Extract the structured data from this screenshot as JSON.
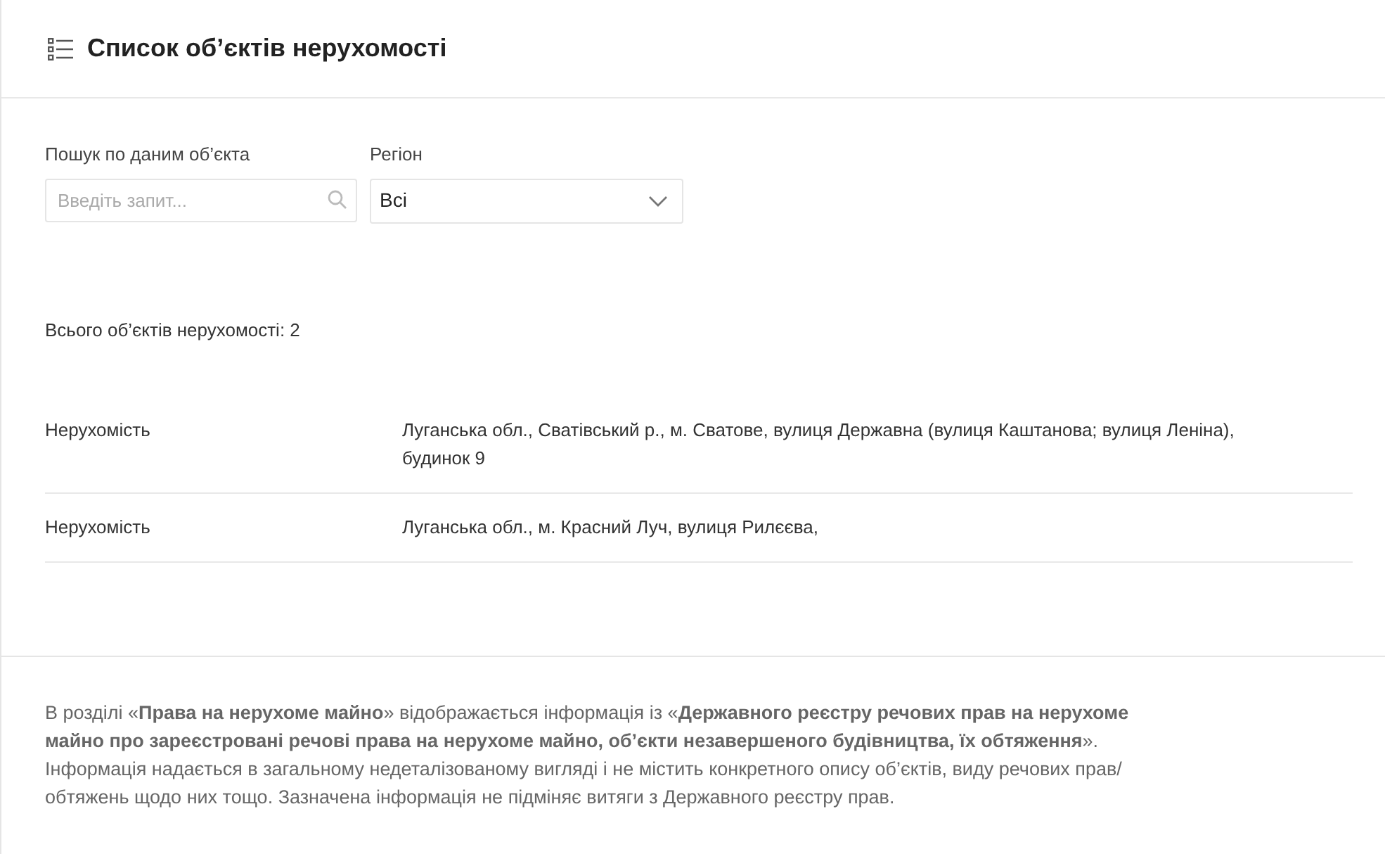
{
  "header": {
    "title": "Список об’єктів нерухомості"
  },
  "filters": {
    "search": {
      "label": "Пошук по даним об’єкта",
      "placeholder": "Введіть запит..."
    },
    "region": {
      "label": "Регіон",
      "value": "Всі"
    }
  },
  "total": "Всього об’єктів нерухомості: 2",
  "rows": [
    {
      "type": "Нерухомість",
      "address": "Луганська обл., Сватівський р., м. Сватове, вулиця Державна (вулиця Каштанова; вулиця Леніна), будинок 9"
    },
    {
      "type": "Нерухомість",
      "address": "Луганська обл., м. Красний Луч, вулиця Рилєєва,"
    }
  ],
  "note": "В розділі «**Права на нерухоме майно**» відображається інформація із «**Державного реєстру речових прав на нерухоме майно про зареєстровані речові права на нерухоме майно, об’єкти незавершеного будівництва, їх обтяження**». Інформація надається в загальному недеталізованому вигляді і не містить конкретного опису об’єктів, виду речових прав/обтяжень щодо них тощо. Зазначена інформація не підміняє витяги з Державного реєстру прав."
}
